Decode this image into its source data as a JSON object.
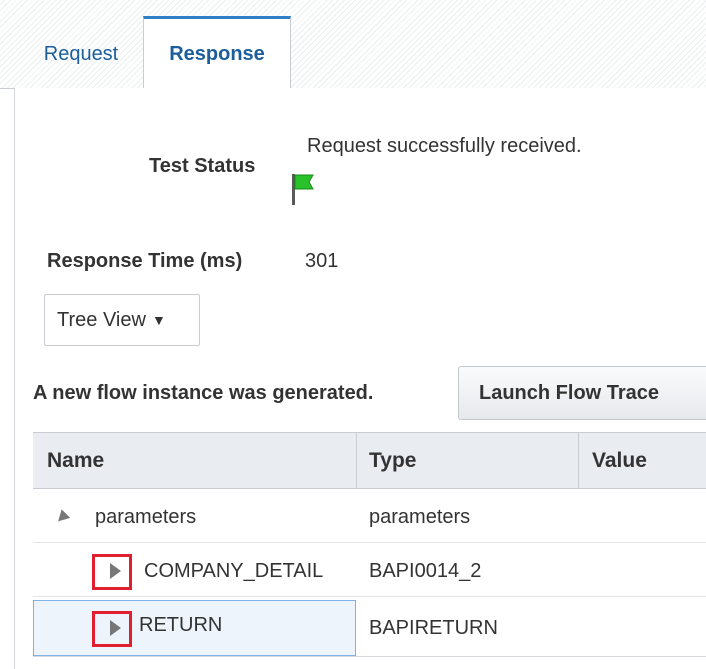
{
  "tabs": [
    {
      "label": "Request",
      "active": false
    },
    {
      "label": "Response",
      "active": true
    }
  ],
  "test_status": {
    "label": "Test Status",
    "message": "Request successfully received.",
    "icon": "green-flag-icon"
  },
  "response_time": {
    "label": "Response Time (ms)",
    "value": "301"
  },
  "view_select": {
    "selected": "Tree View",
    "icon": "dropdown-arrow-icon"
  },
  "flow": {
    "message": "A new flow instance was generated.",
    "button_label": "Launch Flow Trace"
  },
  "grid": {
    "columns": [
      "Name",
      "Type",
      "Value"
    ],
    "rows": [
      {
        "name": "parameters",
        "type": "parameters",
        "value": "",
        "expanded": true
      },
      {
        "name": "COMPANY_DETAIL",
        "type": "BAPI0014_2",
        "value": "",
        "expanded": false
      },
      {
        "name": "RETURN",
        "type": "BAPIRETURN",
        "value": "",
        "expanded": false
      }
    ]
  },
  "colors": {
    "tab_accent": "#2f7fc8",
    "link_blue": "#1b5e9b",
    "highlight_red": "#e0202e",
    "header_bg": "#e9edf1"
  }
}
